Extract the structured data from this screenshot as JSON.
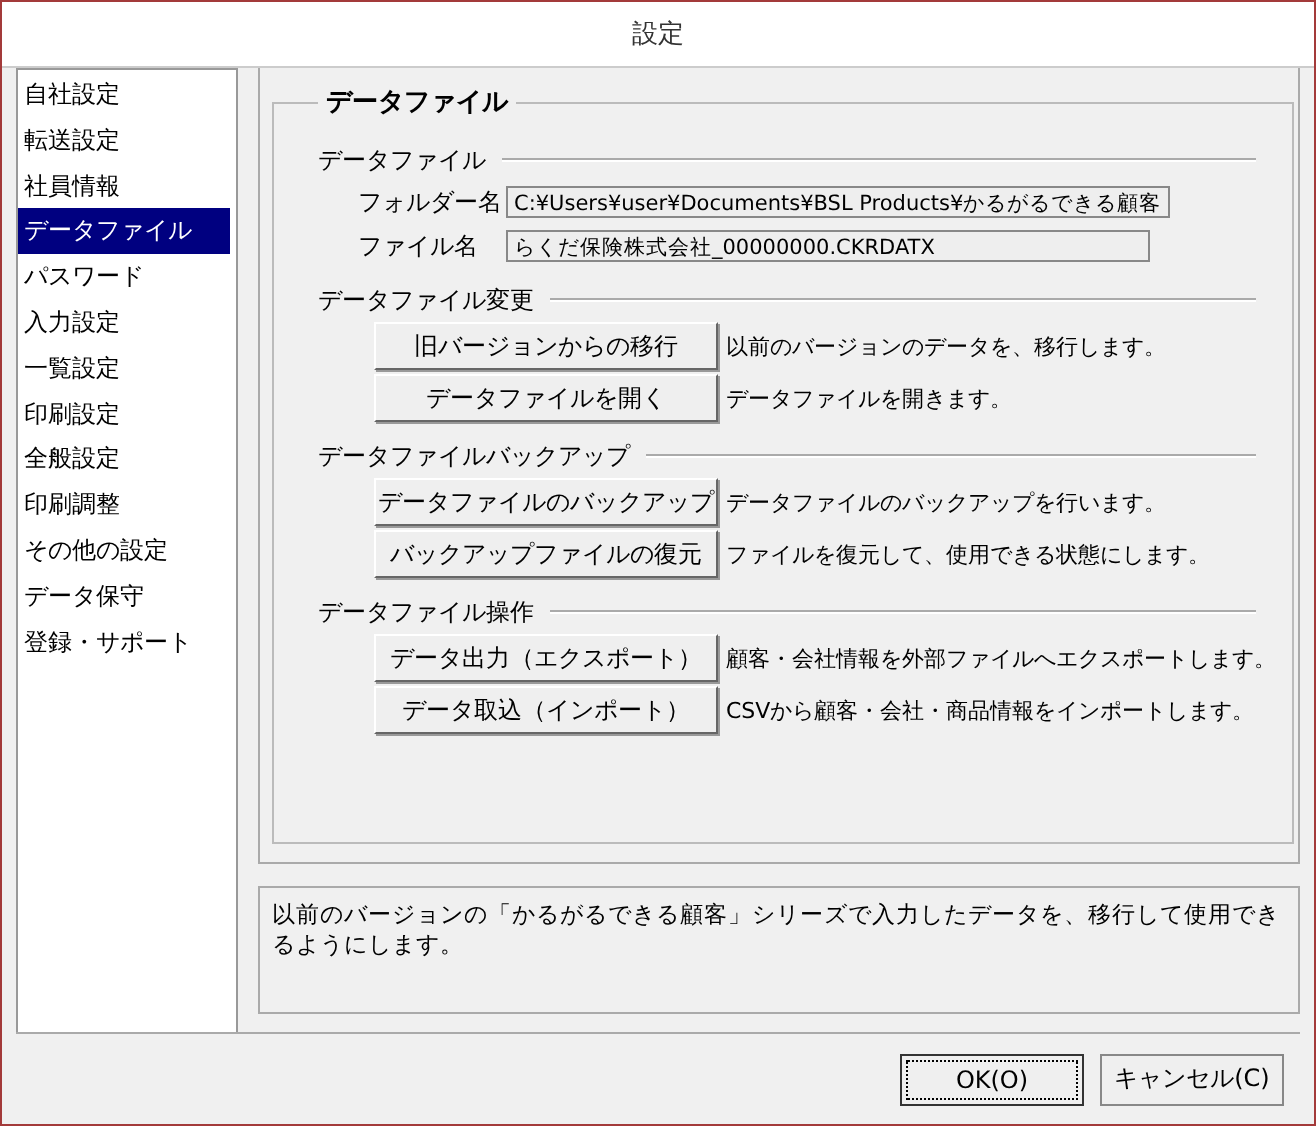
{
  "window": {
    "title": "設定"
  },
  "sidebar": {
    "items": [
      {
        "label": "自社設定",
        "selected": false
      },
      {
        "label": "転送設定",
        "selected": false
      },
      {
        "label": "社員情報",
        "selected": false
      },
      {
        "label": "データファイル",
        "selected": true
      },
      {
        "label": "パスワード",
        "selected": false
      },
      {
        "label": "入力設定",
        "selected": false
      },
      {
        "label": "一覧設定",
        "selected": false
      },
      {
        "label": "印刷設定",
        "selected": false
      },
      {
        "label": "全般設定",
        "selected": false
      },
      {
        "label": "印刷調整",
        "selected": false
      },
      {
        "label": "その他の設定",
        "selected": false
      },
      {
        "label": "データ保守",
        "selected": false
      },
      {
        "label": "登録・サポート",
        "selected": false
      }
    ]
  },
  "panel": {
    "title": "データファイル",
    "sections": [
      {
        "title": "データファイル",
        "rows": [
          {
            "kind": "field",
            "label": "フォルダー名",
            "value": "C:¥Users¥user¥Documents¥BSL Products¥かるがるできる顧客"
          },
          {
            "kind": "field",
            "label": "ファイル名",
            "value": "らくだ保険株式会社_00000000.CKRDATX"
          }
        ]
      },
      {
        "title": "データファイル変更",
        "rows": [
          {
            "kind": "action",
            "label": "旧バージョンからの移行",
            "value": "以前のバージョンのデータを、移行します。"
          },
          {
            "kind": "action",
            "label": "データファイルを開く",
            "value": "データファイルを開きます。"
          }
        ]
      },
      {
        "title": "データファイルバックアップ",
        "rows": [
          {
            "kind": "action",
            "label": "データファイルのバックアップ",
            "value": "データファイルのバックアップを行います。"
          },
          {
            "kind": "action",
            "label": "バックアップファイルの復元",
            "value": "ファイルを復元して、使用できる状態にします。"
          }
        ]
      },
      {
        "title": "データファイル操作",
        "rows": [
          {
            "kind": "action",
            "label": "データ出力（エクスポート）",
            "value": "顧客・会社情報を外部ファイルへエクスポートします。"
          },
          {
            "kind": "action",
            "label": "データ取込（インポート）",
            "value": "CSVから顧客・会社・商品情報をインポートします。"
          }
        ]
      }
    ]
  },
  "description": "以前のバージョンの「かるがるできる顧客」シリーズで入力したデータを、移行して使用できるようにします。",
  "buttons": [
    {
      "label": "OK(O)",
      "default": true
    },
    {
      "label": "キャンセル(C)",
      "default": false
    }
  ]
}
